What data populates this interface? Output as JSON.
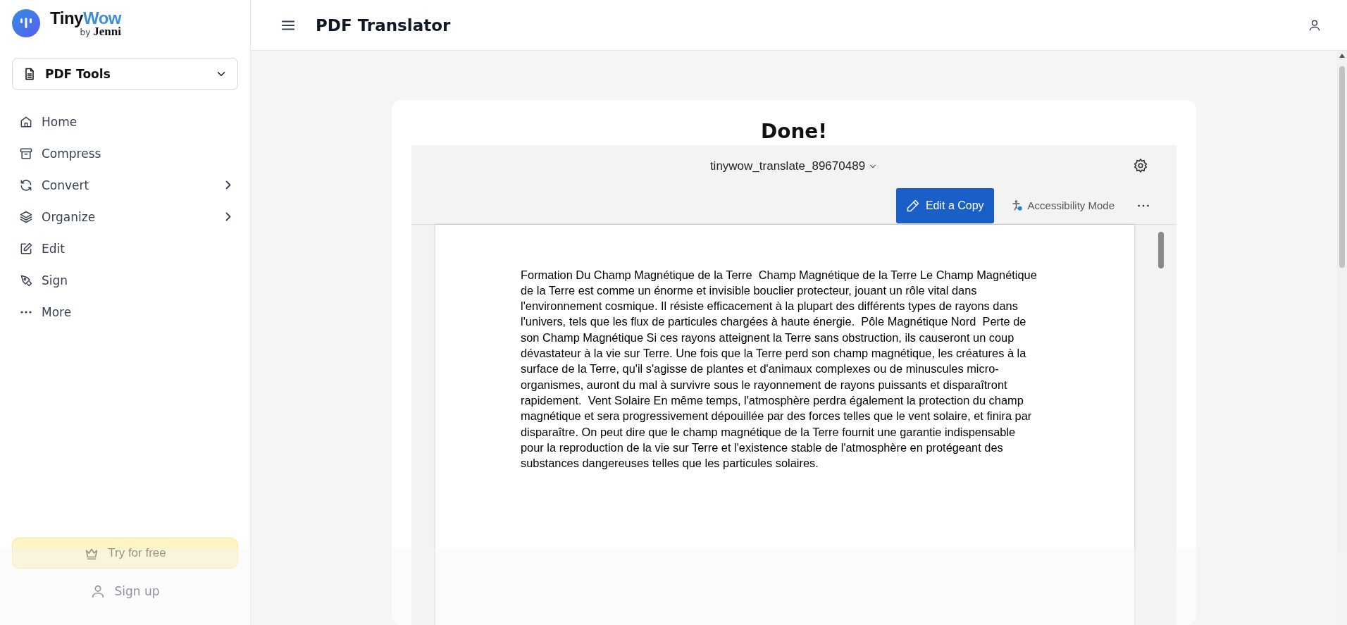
{
  "sidebar": {
    "logo": {
      "word_1": "Tiny",
      "word_2": "Wow",
      "byline_1": "by",
      "byline_2": "Jenni"
    },
    "category_dropdown": {
      "label": "PDF Tools"
    },
    "nav_items": [
      {
        "label": "Home",
        "kind": "home",
        "expandable": false
      },
      {
        "label": "Compress",
        "kind": "archive",
        "expandable": false
      },
      {
        "label": "Convert",
        "kind": "refresh",
        "expandable": true
      },
      {
        "label": "Organize",
        "kind": "layers",
        "expandable": true
      },
      {
        "label": "Edit",
        "kind": "edit",
        "expandable": false
      },
      {
        "label": "Sign",
        "kind": "pen",
        "expandable": false
      },
      {
        "label": "More",
        "kind": "dots",
        "expandable": false
      }
    ],
    "try_button": "Try for free",
    "signup_button": "Sign up"
  },
  "header": {
    "title": "PDF Translator"
  },
  "result": {
    "heading": "Done!",
    "viewer": {
      "file_name": "tinywow_translate_89670489",
      "edit_button": "Edit a Copy",
      "accessibility_button": "Accessibility Mode",
      "document_lines": [
        "Formation Du Champ Magnétique de la Terre  Champ Magnétique de la Terre Le Champ Magnétique",
        "de la Terre est comme un énorme et invisible bouclier protecteur, jouant un rôle vital dans",
        "l'environnement cosmique. Il résiste efficacement à la plupart des différents types de rayons dans",
        "l'univers, tels que les flux de particules chargées à haute énergie.  Pôle Magnétique Nord  Perte de",
        "son Champ Magnétique Si ces rayons atteignent la Terre sans obstruction, ils causeront un coup",
        "dévastateur à la vie sur Terre. Une fois que la Terre perd son champ magnétique, les créatures à la",
        "surface de la Terre, qu'il s'agisse de plantes et d'animaux complexes ou de minuscules micro-",
        "organismes, auront du mal à survivre sous le rayonnement de rayons puissants et disparaîtront",
        "rapidement.  Vent Solaire En même temps, l'atmosphère perdra également la protection du champ",
        "magnétique et sera progressivement dépouillée par des forces telles que le vent solaire, et finira par",
        "disparaître. On peut dire que le champ magnétique de la Terre fournit une garantie indispensable",
        "pour la reproduction de la vie sur Terre et l'existence stable de l'atmosphère en protégeant des",
        "substances dangereuses telles que les particules solaires."
      ]
    }
  }
}
